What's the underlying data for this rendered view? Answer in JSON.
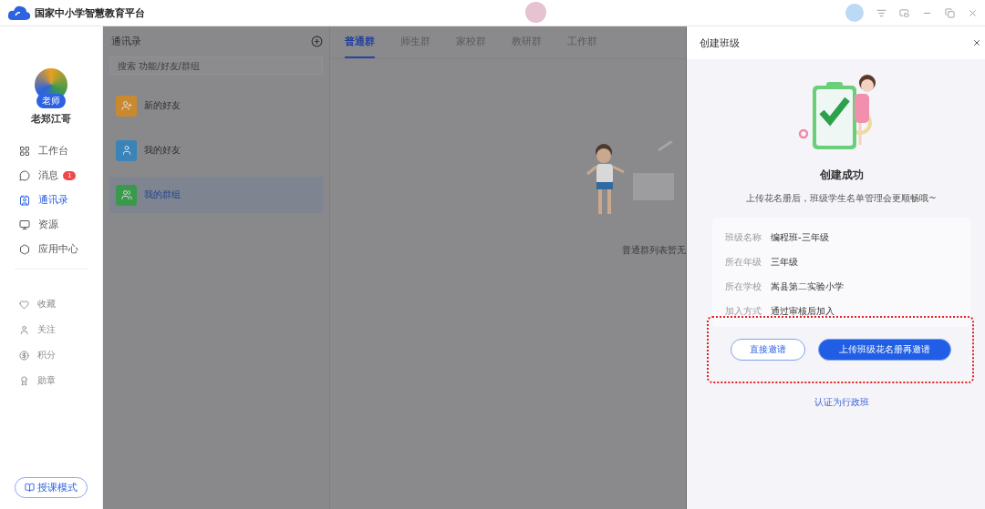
{
  "window": {
    "title": "国家中小学智慧教育平台"
  },
  "sidebar": {
    "user_name": "老郑江哥",
    "role": "老师",
    "nav": [
      {
        "label": "工作台",
        "selected": false
      },
      {
        "label": "消息",
        "selected": false,
        "badge": "1"
      },
      {
        "label": "通讯录",
        "selected": true
      },
      {
        "label": "资源",
        "selected": false
      },
      {
        "label": "应用中心",
        "selected": false
      }
    ],
    "secondary": [
      {
        "label": "收藏"
      },
      {
        "label": "关注"
      },
      {
        "label": "积分"
      },
      {
        "label": "勋章"
      }
    ],
    "mode_button": "授课模式"
  },
  "contacts": {
    "title": "通讯录",
    "search": {
      "placeholder": "搜索 功能/好友/群组"
    },
    "items": [
      {
        "label": "新的好友",
        "color": "#c9892f",
        "selected": false
      },
      {
        "label": "我的好友",
        "color": "#3a84b9",
        "selected": false
      },
      {
        "label": "我的群组",
        "color": "#3a9a4c",
        "selected": true
      }
    ]
  },
  "group_tabs": [
    {
      "label": "普通群",
      "selected": true
    },
    {
      "label": "师生群",
      "selected": false
    },
    {
      "label": "家校群",
      "selected": false
    },
    {
      "label": "教研群",
      "selected": false
    },
    {
      "label": "工作群",
      "selected": false
    }
  ],
  "empty_text": "普通群列表暂无",
  "drawer": {
    "title": "创建班级",
    "success_title": "创建成功",
    "success_hint": "上传花名册后，班级学生名单管理会更顺畅哦~",
    "details": [
      {
        "label": "班级名称",
        "value": "编程班-三年级"
      },
      {
        "label": "所在年级",
        "value": "三年级"
      },
      {
        "label": "所在学校",
        "value": "嵩县第二实验小学"
      },
      {
        "label": "加入方式",
        "value": "通过审核后加入"
      }
    ],
    "buttons": [
      {
        "label": "直接邀请",
        "kind": "outline"
      },
      {
        "label": "上传班级花名册再邀请",
        "kind": "primary"
      }
    ],
    "link": "认证为行政班"
  }
}
